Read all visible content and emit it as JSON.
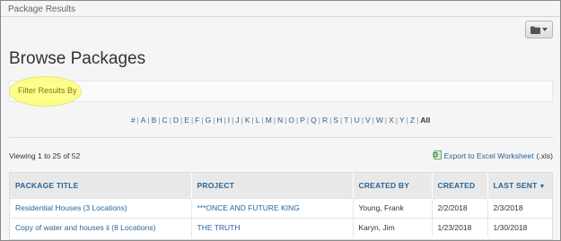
{
  "breadcrumb": "Package Results",
  "toolbar": {
    "folder_icon": "folder-icon",
    "caret_icon": "caret-down-icon"
  },
  "page_title": "Browse Packages",
  "filter": {
    "label": "Filter Results By",
    "highlight_color": "#ffff66"
  },
  "alphabet": [
    "#",
    "A",
    "B",
    "C",
    "D",
    "E",
    "F",
    "G",
    "H",
    "I",
    "J",
    "K",
    "L",
    "M",
    "N",
    "O",
    "P",
    "Q",
    "R",
    "S",
    "T",
    "U",
    "V",
    "W",
    "X",
    "Y",
    "Z",
    "All"
  ],
  "alphabet_active": "All",
  "viewing_text": "Viewing 1 to 25 of 52",
  "export": {
    "label": "Export to Excel Worksheet",
    "ext": "(.xls)",
    "icon": "excel-icon"
  },
  "table": {
    "columns": [
      "PACKAGE TITLE",
      "PROJECT",
      "CREATED BY",
      "CREATED",
      "LAST SENT"
    ],
    "sort_column": "LAST SENT",
    "sort_direction": "desc",
    "rows": [
      {
        "title": "Residential Houses (3 Locations)",
        "project": "***ONCE AND FUTURE KING",
        "created_by": "Young, Frank",
        "created": "2/2/2018",
        "last_sent": "2/3/2018"
      },
      {
        "title": "Copy of water and houses ii (8 Locations)",
        "project": "THE TRUTH",
        "created_by": "Karyn, Jim",
        "created": "1/23/2018",
        "last_sent": "1/30/2018"
      }
    ]
  },
  "colors": {
    "link": "#2a6496",
    "header_bg": "#e9e9e9",
    "page_bg": "#f5f5f5"
  }
}
